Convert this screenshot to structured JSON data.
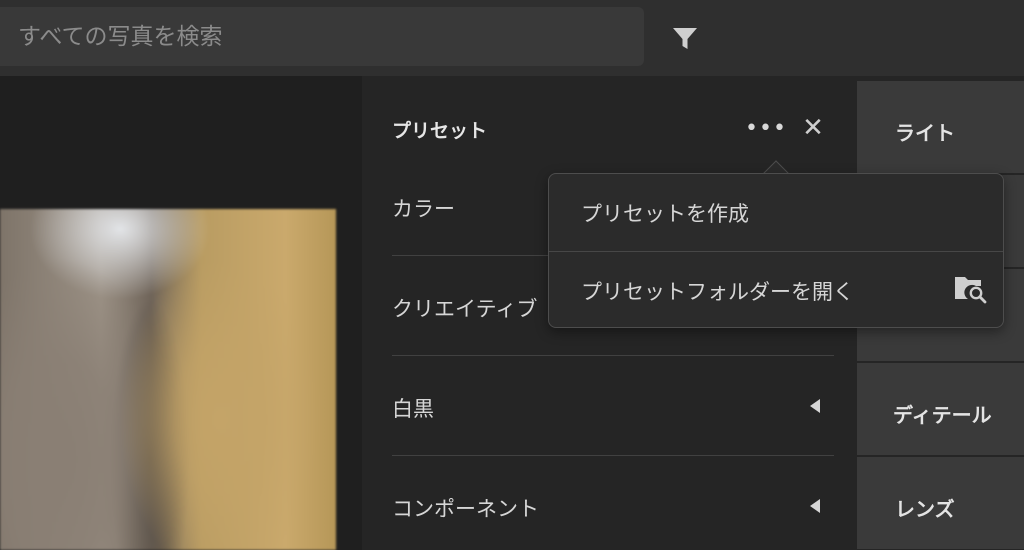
{
  "search": {
    "placeholder": "すべての写真を検索",
    "value": ""
  },
  "filter": {
    "icon": "filter-icon"
  },
  "presets_panel": {
    "title": "プリセット",
    "more_icon": "more-horizontal-icon",
    "more_label": "•••",
    "close_icon": "close-icon",
    "close_label": "✕",
    "groups": [
      {
        "label": "カラー"
      },
      {
        "label": "クリエイティブ"
      },
      {
        "label": "白黒"
      },
      {
        "label": "コンポーネント"
      }
    ]
  },
  "menu": {
    "items": [
      {
        "label": "プリセットを作成"
      },
      {
        "label": "プリセットフォルダーを開く",
        "icon": "folder-search-icon"
      }
    ]
  },
  "edit_tabs": [
    {
      "label": "ライト"
    },
    {
      "label": ""
    },
    {
      "label": ""
    },
    {
      "label": "ディテール"
    },
    {
      "label": "レンズ"
    }
  ],
  "colors": {
    "topbar_bg": "#2f2f2f",
    "panel_bg": "#252525",
    "tab_bg": "#3a3a3a",
    "popover_bg": "#2b2b2b"
  }
}
